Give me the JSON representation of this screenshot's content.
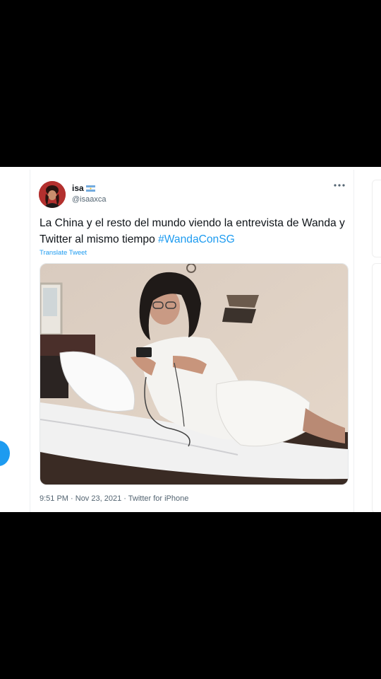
{
  "tweet": {
    "display_name": "isa",
    "handle": "@isaaxca",
    "text": "La China y el resto del mundo viendo la entrevista de Wanda y Twitter al mismo tiempo ",
    "hashtag": "#WandaConSG",
    "translate_label": "Translate Tweet",
    "time": "9:51 PM",
    "separator1": " · ",
    "date": "Nov 23, 2021",
    "separator2": " · ",
    "source": "Twitter for iPhone"
  },
  "icons": {
    "more": "more-horizontal-icon",
    "flag": "argentina-flag-icon"
  },
  "colors": {
    "link": "#1d9bf0",
    "text": "#0f1419",
    "secondary": "#536471"
  }
}
